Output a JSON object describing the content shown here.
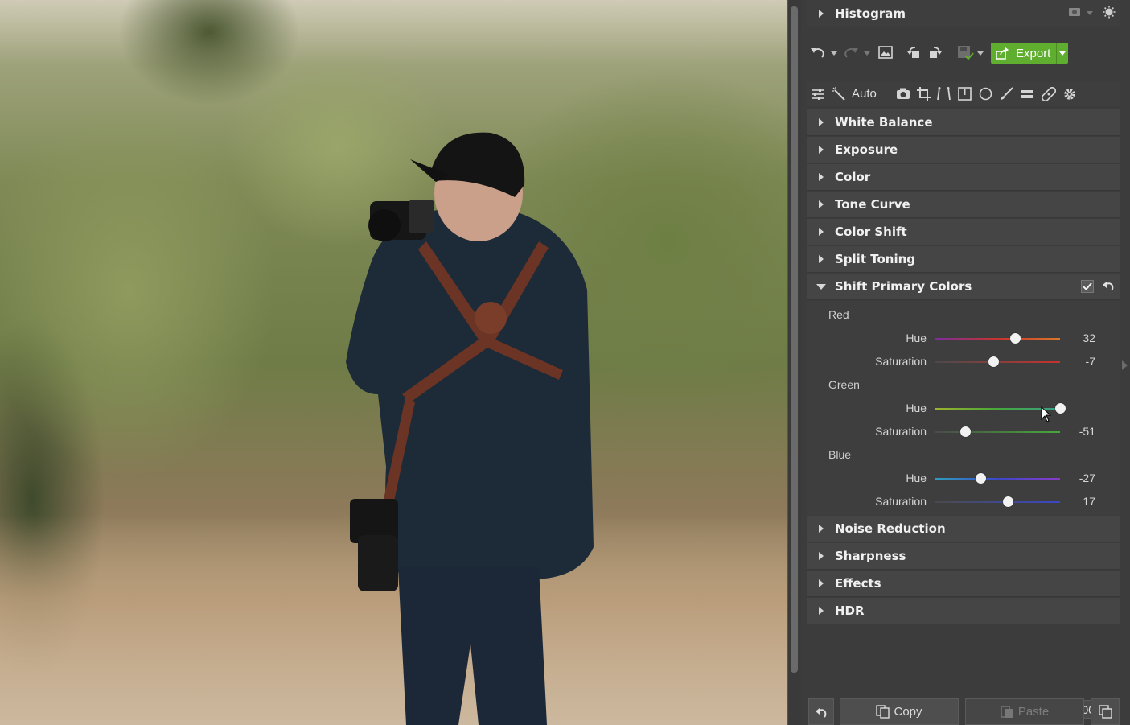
{
  "photo": {
    "alt_subject": "photographer in dark shirt with leather camera harness, trees background"
  },
  "panel": {
    "histogram": {
      "label": "Histogram"
    },
    "toolbar": {
      "export_label": "Export"
    },
    "tools": {
      "auto_label": "Auto"
    },
    "sections_top": [
      {
        "label": "White Balance"
      },
      {
        "label": "Exposure"
      },
      {
        "label": "Color"
      },
      {
        "label": "Tone Curve"
      },
      {
        "label": "Color Shift"
      },
      {
        "label": "Split Toning"
      }
    ],
    "shift_primary": {
      "label": "Shift Primary Colors",
      "groups": [
        {
          "name": "Red",
          "hue": {
            "label": "Hue",
            "value": "32",
            "fraction": 0.642
          },
          "saturation": {
            "label": "Saturation",
            "value": "-7",
            "fraction": 0.465
          }
        },
        {
          "name": "Green",
          "hue": {
            "label": "Hue",
            "value": "100",
            "fraction": 1.0
          },
          "saturation": {
            "label": "Saturation",
            "value": "-51",
            "fraction": 0.245
          }
        },
        {
          "name": "Blue",
          "hue": {
            "label": "Hue",
            "value": "-27",
            "fraction": 0.365
          },
          "saturation": {
            "label": "Saturation",
            "value": "17",
            "fraction": 0.585
          }
        }
      ]
    },
    "sections_bottom": [
      {
        "label": "Noise Reduction"
      },
      {
        "label": "Sharpness"
      },
      {
        "label": "Effects"
      },
      {
        "label": "HDR"
      }
    ],
    "bottom": {
      "copy_label": "Copy",
      "paste_label": "Paste"
    }
  },
  "colors": {
    "export_green": "#5fae2f",
    "red_track": "#c8322e",
    "green_track": "#46a83a",
    "blue_track": "#3a48c8"
  }
}
